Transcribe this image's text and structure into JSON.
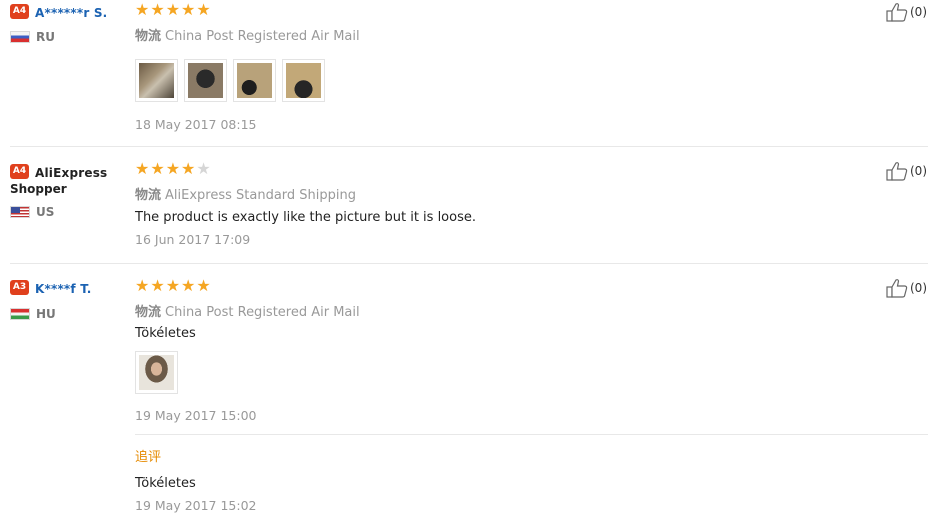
{
  "reviews": [
    {
      "badge": "A4",
      "name": "A******r S.",
      "name_line2": "",
      "country": "RU",
      "rating": 5,
      "shipping_label": "物流",
      "shipping_method": "China Post Registered Air Mail",
      "text": "",
      "photos": [
        "product-photo-1",
        "product-photo-2",
        "product-photo-3",
        "product-photo-4"
      ],
      "date": "18 May 2017 08:15",
      "likes": "(0)"
    },
    {
      "badge": "A4",
      "name": "AliExpress",
      "name_line2": "Shopper",
      "country": "US",
      "rating": 4,
      "shipping_label": "物流",
      "shipping_method": "AliExpress Standard Shipping",
      "text": "The product is exactly like the picture but it is loose.",
      "photos": [],
      "date": "16 Jun 2017 17:09",
      "likes": "(0)"
    },
    {
      "badge": "A3",
      "name": "K****f T.",
      "name_line2": "",
      "country": "HU",
      "rating": 5,
      "shipping_label": "物流",
      "shipping_method": "China Post Registered Air Mail",
      "text": "Tökéletes",
      "photos": [
        "buyer-photo-1"
      ],
      "date": "19 May 2017 15:00",
      "followup_label": "追评",
      "followup_text": "Tökéletes",
      "followup_date": "19 May 2017 15:02",
      "likes": "(0)"
    }
  ],
  "colors": {
    "star": "#f5a623",
    "badge": "#e0401d",
    "username": "#1b62b2",
    "followup": "#e68a00"
  }
}
